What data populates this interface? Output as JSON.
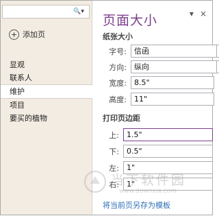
{
  "nav": {
    "search_icon": "🔍",
    "search_dropdown": "▾",
    "add_page_label": "添加页",
    "pages": [
      {
        "label": "显观"
      },
      {
        "label": "联系人"
      },
      {
        "label": "维护"
      },
      {
        "label": "项目"
      },
      {
        "label": "要买的植物"
      }
    ]
  },
  "pane": {
    "title": "页面大小",
    "dropdown_glyph": "▾",
    "close_glyph": "×",
    "paper_section": "纸张大小",
    "size_label": "字号:",
    "size_value": "信函",
    "orientation_label": "方向:",
    "orientation_value": "纵向",
    "width_label": "宽度:",
    "width_value": "8.5\"",
    "height_label": "高度:",
    "height_value": "11\"",
    "margin_section": "打印页边距",
    "top_label": "上:",
    "top_value": "1.5\"",
    "bottom_label": "下:",
    "bottom_value": "0.5\"",
    "left_label": "左:",
    "left_value": "1\"",
    "right_label": "右:",
    "right_value": "1\"",
    "save_template_link": "将当前页另存为模板"
  },
  "watermark": {
    "text": "当下软件园",
    "url": "www.downxia.com"
  },
  "colors": {
    "accent": "#7c3f8c",
    "nav_bg": "#f3ece3",
    "link": "#2e6fb7"
  }
}
